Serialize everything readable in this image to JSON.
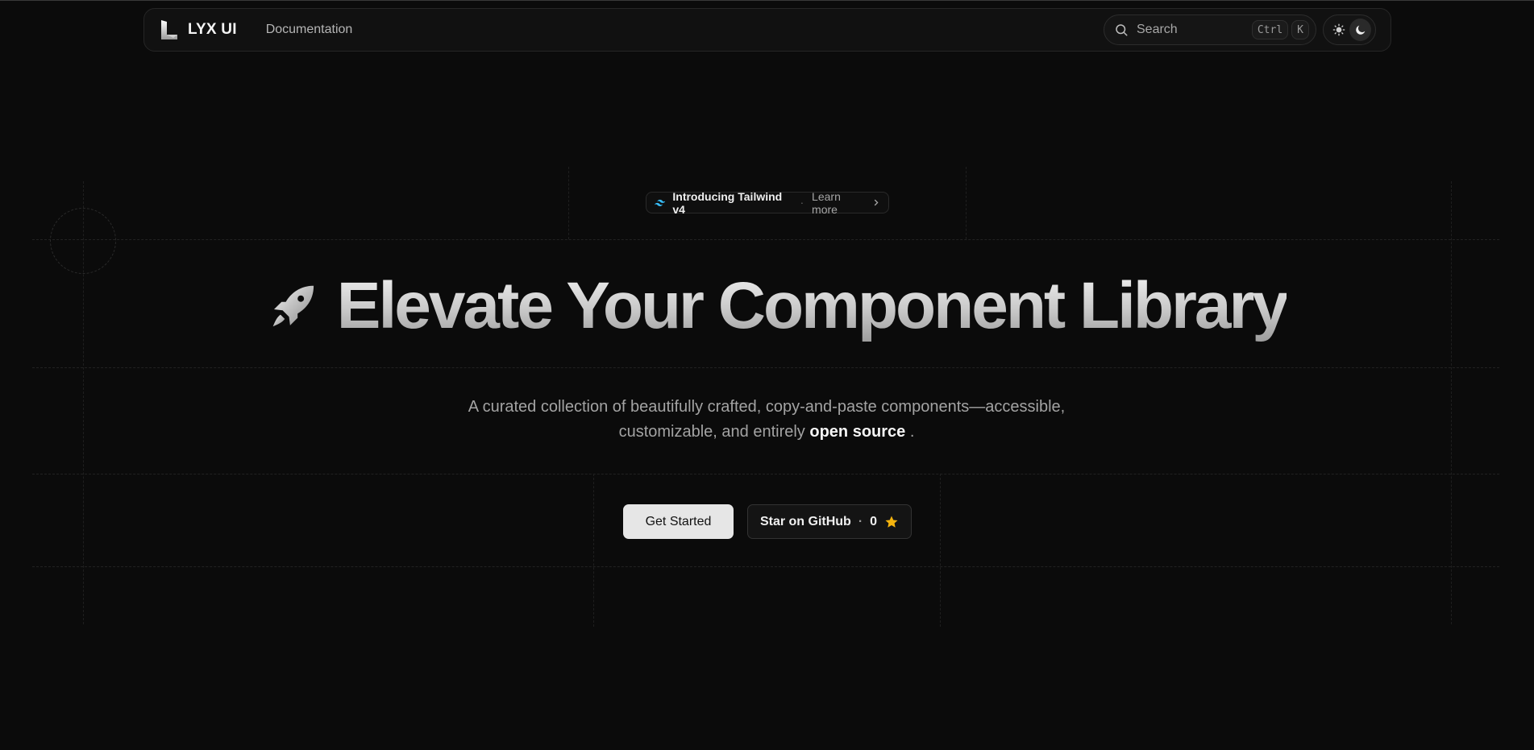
{
  "nav": {
    "brand": "LYX UI",
    "links": [
      "Documentation"
    ],
    "search": {
      "placeholder": "Search",
      "shortcut": [
        "Ctrl",
        "K"
      ]
    },
    "theme": {
      "options": [
        "light",
        "dark"
      ],
      "active": "dark"
    }
  },
  "announcement": {
    "text": "Introducing Tailwind v4",
    "separator": "·",
    "link": "Learn more"
  },
  "hero": {
    "title": "Elevate Your Component Library",
    "subtitle_pre": "A curated collection of beautifully crafted, copy-and-paste components—accessible, customizable, and entirely",
    "subtitle_highlight": "open source",
    "subtitle_post": "."
  },
  "cta": {
    "primary": "Get Started",
    "secondary": {
      "label": "Star on GitHub",
      "separator": "·",
      "count": "0"
    }
  },
  "colors": {
    "background": "#0b0b0b",
    "star": "#f5b40e",
    "tailwind": "#38bdf8"
  },
  "icons": [
    "brand-logo-icon",
    "search-icon",
    "sun-icon",
    "moon-icon",
    "tailwind-icon",
    "chevron-right-icon",
    "rocket-icon",
    "star-icon"
  ]
}
